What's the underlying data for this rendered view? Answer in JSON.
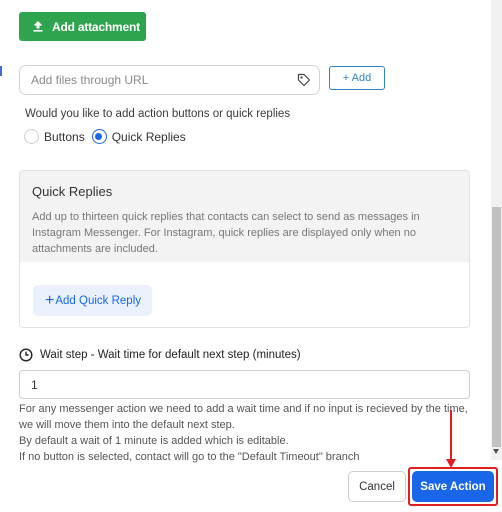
{
  "attachment": {
    "button_label": "Add attachment",
    "icon": "upload-icon"
  },
  "url_field": {
    "placeholder": "Add files through URL",
    "value": "",
    "icon": "tag-icon"
  },
  "add_button": {
    "label": "+ Add"
  },
  "action_question": "Would you like to add action buttons or quick replies",
  "action_type": {
    "options": [
      {
        "label": "Buttons",
        "checked": false
      },
      {
        "label": "Quick Replies",
        "checked": true
      }
    ]
  },
  "quick_replies": {
    "title": "Quick Replies",
    "description": "Add up to thirteen quick replies that contacts can select to send as messages in Instagram Messenger. For Instagram, quick replies are displayed only when no attachments are included.",
    "add_label": "Add Quick Reply"
  },
  "wait_step": {
    "label": "Wait step - Wait time for default next step (minutes)",
    "value": "1",
    "icon": "clock-icon",
    "notes": [
      "For any messenger action we need to add a wait time and if no input is recieved by the time, we will move them into the default next step.",
      "By default a wait of 1 minute is added which is editable.",
      "If no button is selected, contact will go to the \"Default Timeout\" branch"
    ]
  },
  "footer": {
    "cancel_label": "Cancel",
    "save_label": "Save Action"
  },
  "colors": {
    "primary": "#1a66e8",
    "success": "#2ea44f",
    "annotation": "#e02020",
    "link": "#2e86c1"
  }
}
